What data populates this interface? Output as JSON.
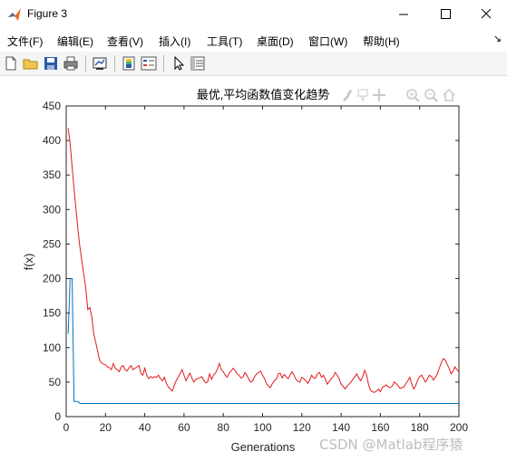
{
  "window": {
    "title": "Figure 3",
    "minimize_label": "minimize",
    "maximize_label": "maximize",
    "close_label": "close"
  },
  "menu": {
    "items": [
      "文件(F)",
      "编辑(E)",
      "查看(V)",
      "插入(I)",
      "工具(T)",
      "桌面(D)",
      "窗口(W)",
      "帮助(H)"
    ],
    "overflow": "↘"
  },
  "toolbar": {
    "icons": [
      "new-figure-icon",
      "open-file-icon",
      "save-icon",
      "print-icon",
      "link-plot-icon",
      "colorbar-icon",
      "legend-icon",
      "pointer-icon",
      "property-editor-icon"
    ]
  },
  "axes_toolbar": {
    "icons": [
      "brush-icon",
      "data-tips-icon",
      "pan-icon",
      "zoom-in-icon",
      "zoom-out-icon",
      "home-icon"
    ]
  },
  "colors": {
    "series_red": "#e41a1c",
    "series_blue": "#0072bd"
  },
  "chart_data": {
    "type": "line",
    "title": "最优,平均函数值变化趋势",
    "xlabel": "Generations",
    "ylabel": "f(x)",
    "xlim": [
      0,
      200
    ],
    "ylim": [
      0,
      450
    ],
    "xticks": [
      0,
      20,
      40,
      60,
      80,
      100,
      120,
      140,
      160,
      180,
      200
    ],
    "yticks": [
      0,
      50,
      100,
      150,
      200,
      250,
      300,
      350,
      400,
      450
    ],
    "grid": false,
    "series": [
      {
        "color": "#e41a1c",
        "x": [
          1,
          2,
          3,
          4,
          5,
          6,
          7,
          8,
          9,
          10,
          11,
          12,
          13,
          14,
          15,
          16,
          17,
          18,
          19,
          20,
          21,
          22,
          23,
          24,
          25,
          26,
          27,
          28,
          29,
          30,
          31,
          32,
          33,
          34,
          35,
          36,
          37,
          38,
          39,
          40,
          41,
          42,
          43,
          44,
          45,
          46,
          47,
          48,
          49,
          50,
          51,
          52,
          53,
          54,
          55,
          56,
          57,
          58,
          59,
          60,
          61,
          62,
          63,
          64,
          65,
          66,
          67,
          68,
          69,
          70,
          71,
          72,
          73,
          74,
          75,
          76,
          77,
          78,
          79,
          80,
          81,
          82,
          83,
          84,
          85,
          86,
          87,
          88,
          89,
          90,
          91,
          92,
          93,
          94,
          95,
          96,
          97,
          98,
          99,
          100,
          101,
          102,
          103,
          104,
          105,
          106,
          107,
          108,
          109,
          110,
          111,
          112,
          113,
          114,
          115,
          116,
          117,
          118,
          119,
          120,
          121,
          122,
          123,
          124,
          125,
          126,
          127,
          128,
          129,
          130,
          131,
          132,
          133,
          134,
          135,
          136,
          137,
          138,
          139,
          140,
          141,
          142,
          143,
          144,
          145,
          146,
          147,
          148,
          149,
          150,
          151,
          152,
          153,
          154,
          155,
          156,
          157,
          158,
          159,
          160,
          161,
          162,
          163,
          164,
          165,
          166,
          167,
          168,
          169,
          170,
          171,
          172,
          173,
          174,
          175,
          176,
          177,
          178,
          179,
          180,
          181,
          182,
          183,
          184,
          185,
          186,
          187,
          188,
          189,
          190,
          191,
          192,
          193,
          194,
          195,
          196,
          197,
          198,
          199,
          200
        ],
        "y": [
          418,
          395,
          362,
          330,
          300,
          270,
          245,
          225,
          205,
          185,
          155,
          158,
          145,
          120,
          108,
          95,
          82,
          78,
          76,
          75,
          72,
          71,
          68,
          77,
          70,
          68,
          65,
          72,
          74,
          68,
          66,
          71,
          74,
          68,
          70,
          72,
          74,
          63,
          60,
          70,
          60,
          55,
          58,
          56,
          58,
          57,
          60,
          55,
          52,
          57,
          48,
          43,
          40,
          37,
          45,
          52,
          57,
          62,
          68,
          60,
          52,
          58,
          63,
          56,
          50,
          54,
          55,
          56,
          58,
          53,
          49,
          50,
          62,
          54,
          60,
          63,
          69,
          77,
          68,
          65,
          60,
          57,
          63,
          66,
          70,
          67,
          62,
          60,
          56,
          57,
          64,
          60,
          54,
          50,
          52,
          58,
          62,
          64,
          66,
          60,
          55,
          48,
          44,
          42,
          48,
          52,
          54,
          62,
          63,
          56,
          61,
          58,
          55,
          60,
          65,
          60,
          54,
          51,
          50,
          57,
          55,
          52,
          48,
          53,
          60,
          56,
          56,
          62,
          64,
          57,
          60,
          54,
          47,
          51,
          55,
          58,
          64,
          60,
          55,
          47,
          44,
          40,
          44,
          47,
          50,
          54,
          58,
          62,
          56,
          52,
          58,
          67,
          60,
          46,
          38,
          36,
          35,
          37,
          40,
          36,
          42,
          44,
          46,
          43,
          42,
          44,
          50,
          48,
          45,
          41,
          42,
          43,
          48,
          52,
          57,
          47,
          40,
          45,
          53,
          58,
          60,
          55,
          50,
          55,
          60,
          58,
          53,
          57,
          62,
          70,
          78,
          84,
          82,
          76,
          70,
          62,
          66,
          72,
          68,
          65
        ]
      },
      {
        "color": "#0072bd",
        "x": [
          1,
          2,
          3,
          4,
          5,
          6,
          7,
          10,
          20,
          40,
          60,
          80,
          100,
          120,
          140,
          160,
          180,
          200
        ],
        "y": [
          120,
          200,
          200,
          22,
          22,
          22,
          19,
          19,
          19,
          19,
          19,
          19,
          19,
          19,
          19,
          19,
          19,
          19
        ]
      }
    ]
  },
  "watermark": "CSDN @Matlab程序猿"
}
